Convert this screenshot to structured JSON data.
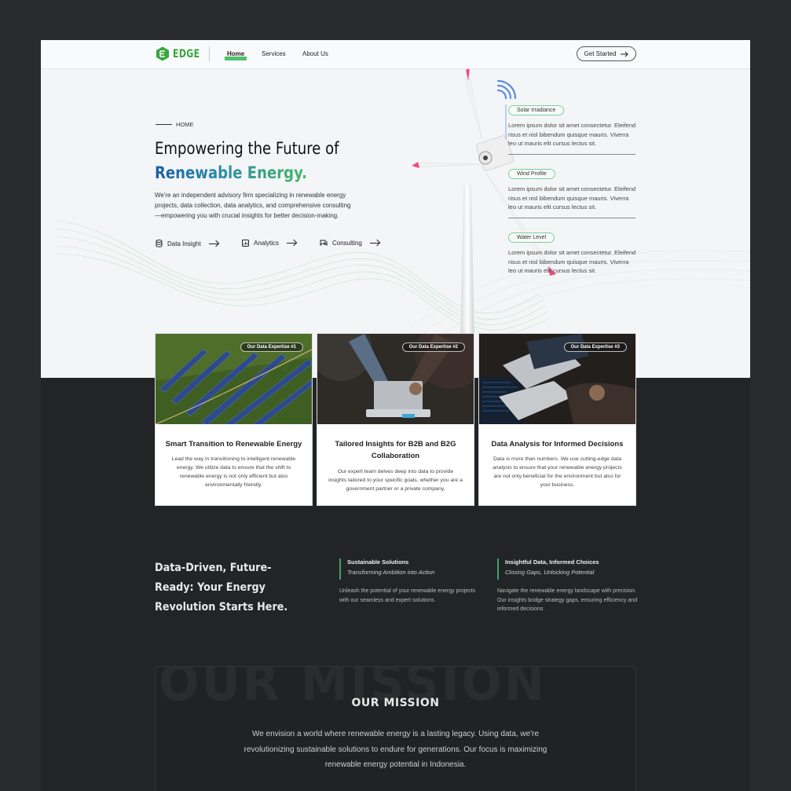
{
  "nav": {
    "logo_text": "EDGE",
    "links": [
      "Home",
      "Services",
      "About Us"
    ],
    "cta_label": "Get Started"
  },
  "hero": {
    "tag": "HOME",
    "title_line1": "Empowering the Future of",
    "title_line2": "Renewable Energy.",
    "description": "We're an independent advisory firm specializing in renewable energy projects, data collection, data analytics, and comprehensive consulting—empowering you with crucial insights for better decision-making.",
    "links": [
      "Data Insight",
      "Analytics",
      "Consulting"
    ]
  },
  "info_panel": [
    {
      "label": "Solar Irradiance",
      "text": "Lorem ipsum dolor sit amet consectetur. Eleifend risus et nisl bibendum quisque mauris. Viverra leo ut mauris elit cursus lectus sit."
    },
    {
      "label": "Wind Profile",
      "text": "Lorem ipsum dolor sit amet consectetur. Eleifend risus et nisl bibendum quisque mauris. Viverra leo ut mauris elit cursus lectus sit."
    },
    {
      "label": "Water Level",
      "text": "Lorem ipsum dolor sit amet consectetur. Eleifend risus et nisl bibendum quisque mauris. Viverra leo ut mauris elit cursus lectus sit."
    }
  ],
  "cards": [
    {
      "badge": "Our Data Expertise #1",
      "title": "Smart Transition to Renewable Energy",
      "description": "Lead the way in transitioning to intelligent renewable energy. We utilize data to ensure that the shift to renewable energy is not only efficient but also environmentally friendly."
    },
    {
      "badge": "Our Data Expertise #2",
      "title": "Tailored Insights for B2B and B2G Collaboration",
      "description": "Our expert team delves deep into data to provide insights tailored to your specific goals, whether you are a government partner or a private company."
    },
    {
      "badge": "Our Data Expertise #3",
      "title": "Data Analysis for Informed Decisions",
      "description": "Data is more than numbers. We use cutting-edge data analysis to ensure that your renewable energy projects are not only beneficial for the environment but also for your business."
    }
  ],
  "features_section": {
    "heading": "Data-Driven, Future-Ready: Your Energy Revolution Starts Here.",
    "items": [
      {
        "title": "Sustainable Solutions",
        "subtitle": "Transforming Ambition into Action",
        "description": "Unleash the potential of your renewable energy projects with our seamless and expert solutions."
      },
      {
        "title": "Insightful Data, Informed Choices",
        "subtitle": "Closing Gaps, Unlocking Potential",
        "description": "Navigate the renewable energy landscape with precision. Our insights bridge strategy gaps, ensuring efficiency and informed decisions."
      }
    ]
  },
  "mission": {
    "background_word": "OUR MISSION",
    "title": "OUR MISSION",
    "text": "We envision a world where renewable energy is a lasting legacy. Using data, we're revolutionizing sustainable solutions to endure for generations. Our focus is maximizing renewable energy potential in Indonesia."
  },
  "icons": {
    "logo": "hexagon-logo-icon",
    "cta": "arrow-right-icon",
    "data_insight": "database-icon",
    "analytics": "chart-icon",
    "consulting": "chat-icon",
    "wifi": "wifi-icon"
  },
  "colors": {
    "brand_green": "#3aa53e",
    "accent_blue": "#1c5fa6",
    "dark_bg": "#232426",
    "hero_bg": "#f4f5f7"
  }
}
